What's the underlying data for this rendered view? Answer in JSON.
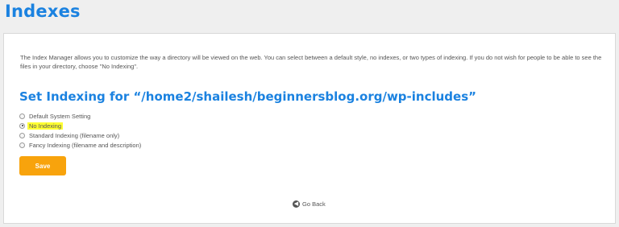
{
  "header": {
    "title": "Indexes"
  },
  "main": {
    "description": "The Index Manager allows you to customize the way a directory will be viewed on the web. You can select between a default style, no indexes, or two types of indexing. If you do not wish for people to be able to see the files in your directory, choose \"No Indexing\".",
    "heading": "Set Indexing for “/home2/shailesh/beginnersblog.org/wp-includes”",
    "options": [
      {
        "label": "Default System Setting",
        "selected": false
      },
      {
        "label": "No Indexing",
        "selected": true
      },
      {
        "label": "Standard Indexing (filename only)",
        "selected": false
      },
      {
        "label": "Fancy Indexing (filename and description)",
        "selected": false
      }
    ],
    "save_label": "Save",
    "go_back_label": "Go Back"
  },
  "colors": {
    "accent": "#1b82e0",
    "save_button": "#f8a30c",
    "highlight": "#ffff33"
  },
  "icons": {
    "back": "arrow-left-circle-icon"
  }
}
